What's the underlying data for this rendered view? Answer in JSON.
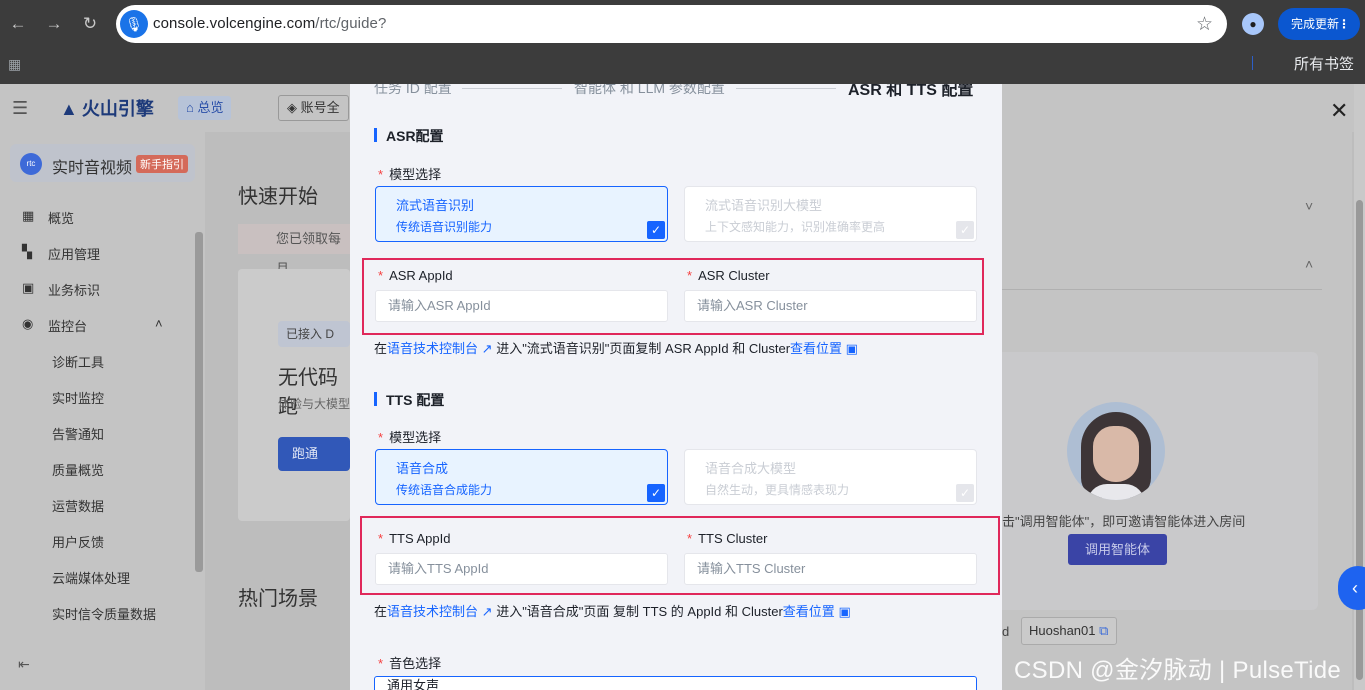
{
  "browser": {
    "url_host": "console.volcengine.com",
    "url_path": "/rtc/guide?",
    "update_label": "完成更新",
    "bookmarks_all": "所有书签"
  },
  "app": {
    "logo_text": "火山引擎",
    "home_label": "总览",
    "account_label": "账号全",
    "product_name": "实时音视频",
    "product_tag": "新手指引",
    "nav_items": [
      {
        "label": "概览",
        "icon": "grid-icon"
      },
      {
        "label": "应用管理",
        "icon": "apps-icon"
      },
      {
        "label": "业务标识",
        "icon": "bookmark-icon"
      },
      {
        "label": "监控台",
        "icon": "monitor-icon"
      }
    ],
    "nav_subitems": [
      "诊断工具",
      "实时监控",
      "告警通知",
      "质量概览",
      "运营数据",
      "用户反馈",
      "云端媒体处理",
      "实时信令质量数据"
    ],
    "quick_start_title": "快速开始",
    "notice_text": "您已领取每月",
    "card_chip": "已接入 D",
    "card_title": "无代码跑",
    "card_subtitle": "体验与大模型",
    "card_button": "跑通",
    "hot_title": "热门场景",
    "agent_text": "击\"调用智能体\"，即可邀请智能体进入房间",
    "agent_button": "调用智能体",
    "id_label": "d",
    "id_value": "Huoshan01"
  },
  "drawer": {
    "steps": [
      "任务 ID 配置",
      "智能体 和 LLM 参数配置",
      "ASR 和 TTS 配置"
    ],
    "asr": {
      "section_title": "ASR配置",
      "model_label": "模型选择",
      "options": [
        {
          "title": "流式语音识别",
          "desc": "传统语音识别能力",
          "selected": true
        },
        {
          "title": "流式语音识别大模型",
          "desc": "上下文感知能力，识别准确率更高",
          "selected": false
        }
      ],
      "appid_label": "ASR AppId",
      "appid_placeholder": "请输入ASR AppId",
      "cluster_label": "ASR Cluster",
      "cluster_placeholder": "请输入ASR Cluster",
      "help_prefix": "在",
      "help_link": "语音技术控制台",
      "help_middle": "进入\"流式语音识别\"页面复制 ASR AppId 和 Cluster",
      "help_view": "查看位置"
    },
    "tts": {
      "section_title": "TTS 配置",
      "model_label": "模型选择",
      "options": [
        {
          "title": "语音合成",
          "desc": "传统语音合成能力",
          "selected": true
        },
        {
          "title": "语音合成大模型",
          "desc": "自然生动，更具情感表现力",
          "selected": false
        }
      ],
      "appid_label": "TTS AppId",
      "appid_placeholder": "请输入TTS AppId",
      "cluster_label": "TTS Cluster",
      "cluster_placeholder": "请输入TTS Cluster",
      "help_prefix": "在",
      "help_link": "语音技术控制台",
      "help_middle": "进入\"语音合成\"页面 复制 TTS 的 AppId 和 Cluster",
      "help_view": "查看位置"
    },
    "voice_label": "音色选择",
    "voice_value": "通用女声"
  },
  "watermark": "CSDN @金汐脉动 | PulseTide",
  "colors": {
    "primary": "#1664ff",
    "highlight": "#e0285a",
    "required": "#f53f3f"
  }
}
